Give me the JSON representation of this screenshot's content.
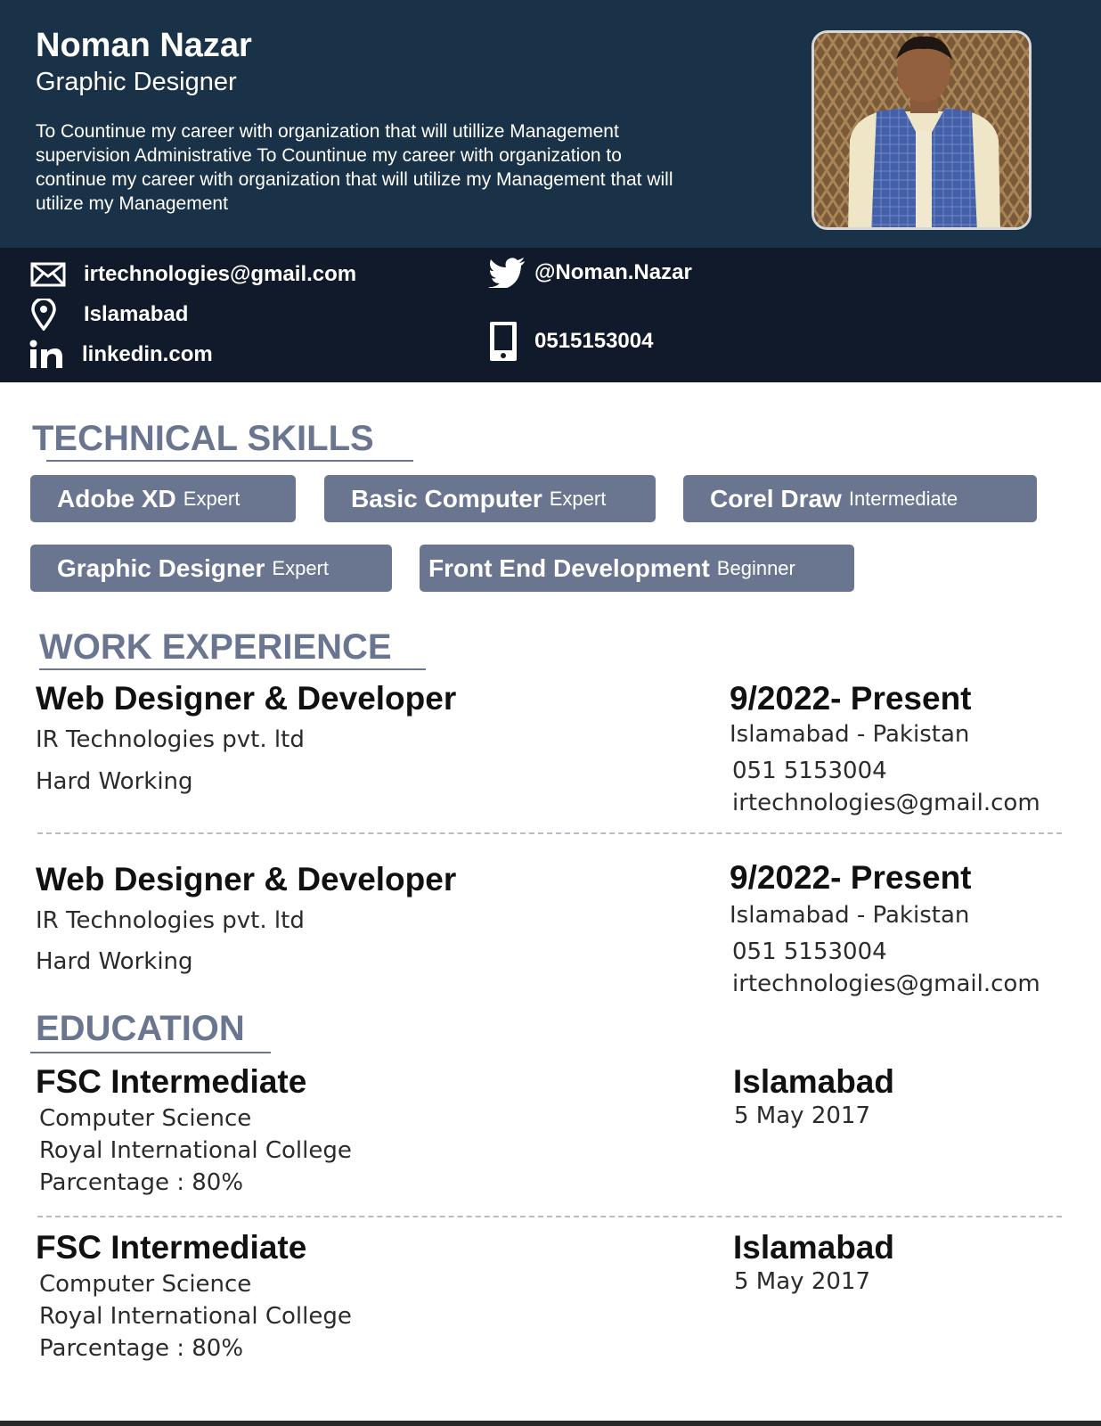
{
  "header": {
    "name": "Noman Nazar",
    "role": "Graphic Designer",
    "summary": "To Countinue my career with organization that will utillize Management supervision Administrative To Countinue my career with organization to continue my career with organization that will utilize my Management that will utilize my Management"
  },
  "contact": {
    "email": "irtechnologies@gmail.com",
    "location": "Islamabad",
    "linkedin": "linkedin.com",
    "twitter": "@Noman.Nazar",
    "phone": "0515153004"
  },
  "skills": {
    "title": "TECHNICAL SKILLS",
    "items": [
      {
        "name": "Adobe XD",
        "level": "Expert"
      },
      {
        "name": "Basic Computer",
        "level": "Expert"
      },
      {
        "name": "Corel Draw",
        "level": "Intermediate"
      },
      {
        "name": "Graphic Designer",
        "level": "Expert"
      },
      {
        "name": "Front End Development",
        "level": "Beginner"
      }
    ]
  },
  "experience": {
    "title": "WORK EXPERIENCE",
    "items": [
      {
        "position": "Web Designer & Developer",
        "company": "IR Technologies pvt. ltd",
        "note": "Hard Working",
        "period": "9/2022- Present",
        "location": "Islamabad - Pakistan",
        "phone": "051 5153004",
        "email": "irtechnologies@gmail.com"
      },
      {
        "position": "Web Designer & Developer",
        "company": "IR Technologies pvt. ltd",
        "note": "Hard Working",
        "period": "9/2022- Present",
        "location": "Islamabad - Pakistan",
        "phone": "051 5153004",
        "email": "irtechnologies@gmail.com"
      }
    ]
  },
  "education": {
    "title": "EDUCATION",
    "items": [
      {
        "degree": "FSC Intermediate",
        "field": "Computer Science",
        "school": "Royal International College",
        "score": "Parcentage : 80%",
        "city": "Islamabad",
        "date": "5 May 2017"
      },
      {
        "degree": "FSC Intermediate",
        "field": "Computer Science",
        "school": "Royal International College",
        "score": "Parcentage : 80%",
        "city": "Islamabad",
        "date": "5 May 2017"
      }
    ]
  },
  "colors": {
    "header_bg": "#1a3248",
    "contact_bg": "#111a2b",
    "accent": "#6a7590"
  },
  "icons": [
    "mail-icon",
    "location-pin-icon",
    "linkedin-icon",
    "twitter-icon",
    "phone-icon"
  ]
}
